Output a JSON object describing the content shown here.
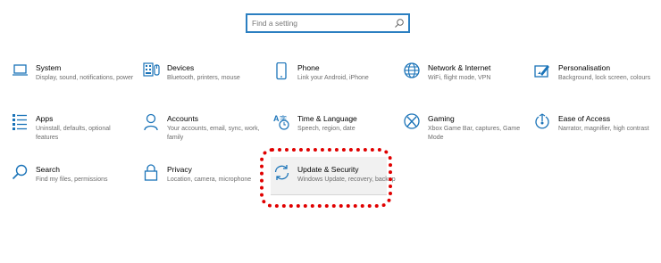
{
  "search": {
    "placeholder": "Find a setting"
  },
  "tiles": [
    {
      "title": "System",
      "desc": "Display, sound, notifications, power",
      "icon": "laptop-icon"
    },
    {
      "title": "Devices",
      "desc": "Bluetooth, printers, mouse",
      "icon": "keyboard-icon"
    },
    {
      "title": "Phone",
      "desc": "Link your Android, iPhone",
      "icon": "phone-icon"
    },
    {
      "title": "Network & Internet",
      "desc": "WiFi, flight mode, VPN",
      "icon": "globe-icon"
    },
    {
      "title": "Personalisation",
      "desc": "Background, lock screen, colours",
      "icon": "paintbrush-icon"
    },
    {
      "title": "Apps",
      "desc": "Uninstall, defaults, optional features",
      "icon": "apps-list-icon"
    },
    {
      "title": "Accounts",
      "desc": "Your accounts, email, sync, work, family",
      "icon": "person-icon"
    },
    {
      "title": "Time & Language",
      "desc": "Speech, region, date",
      "icon": "time-language-icon"
    },
    {
      "title": "Gaming",
      "desc": "Xbox Game Bar, captures, Game Mode",
      "icon": "xbox-icon"
    },
    {
      "title": "Ease of Access",
      "desc": "Narrator, magnifier, high contrast",
      "icon": "ease-of-access-icon"
    },
    {
      "title": "Search",
      "desc": "Find my files, permissions",
      "icon": "search-icon"
    },
    {
      "title": "Privacy",
      "desc": "Location, camera, microphone",
      "icon": "lock-icon"
    },
    {
      "title": "Update & Security",
      "desc": "Windows Update, recovery, backup",
      "icon": "sync-icon"
    }
  ],
  "colors": {
    "accent": "#2b7fc1",
    "annotation": "#e00000",
    "text": "#000000",
    "secondary_text": "#6d6d6d"
  }
}
